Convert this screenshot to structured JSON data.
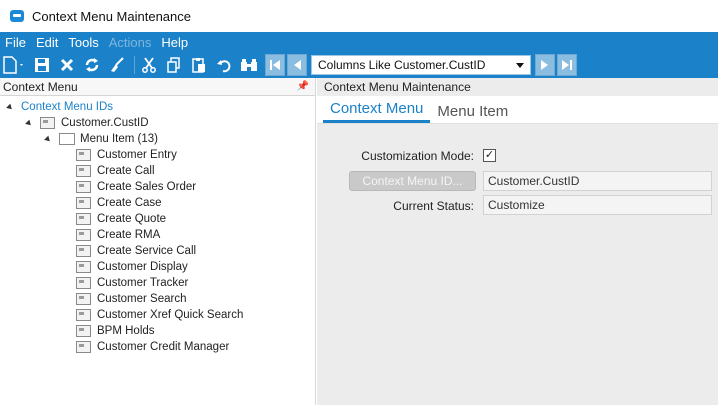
{
  "window": {
    "title": "Context Menu Maintenance"
  },
  "menubar": {
    "items": [
      {
        "label": "File",
        "enabled": true
      },
      {
        "label": "Edit",
        "enabled": true
      },
      {
        "label": "Tools",
        "enabled": true
      },
      {
        "label": "Actions",
        "enabled": false
      },
      {
        "label": "Help",
        "enabled": true
      }
    ]
  },
  "toolbar": {
    "combo_value": "Columns Like Customer.CustID",
    "icons": [
      "new-icon",
      "save-icon",
      "delete-icon",
      "refresh-icon",
      "clear-icon",
      "cut-icon",
      "copy-icon",
      "paste-icon",
      "undo-icon",
      "search-icon"
    ],
    "accent": "#1b82c9"
  },
  "left_pane": {
    "title": "Context Menu",
    "tree": {
      "root": "Context Menu IDs",
      "node": "Customer.CustID",
      "folder": "Menu Item (13)",
      "items": [
        "Customer Entry",
        "Create Call",
        "Create Sales Order",
        "Create Case",
        "Create Quote",
        "Create RMA",
        "Create Service Call",
        "Customer Display",
        "Customer Tracker",
        "Customer Search",
        "Customer Xref Quick Search",
        "BPM Holds",
        "Customer Credit Manager"
      ]
    }
  },
  "right_pane": {
    "title": "Context Menu Maintenance",
    "tabs": [
      {
        "label": "Context Menu",
        "active": true
      },
      {
        "label": "Menu Item",
        "active": false
      }
    ],
    "form": {
      "customization_mode_label": "Customization Mode:",
      "customization_mode_checked": true,
      "checkmark": "✓",
      "context_menu_id_button": "Context Menu ID...",
      "context_menu_id_value": "Customer.CustID",
      "current_status_label": "Current Status:",
      "current_status_value": "Customize"
    }
  }
}
